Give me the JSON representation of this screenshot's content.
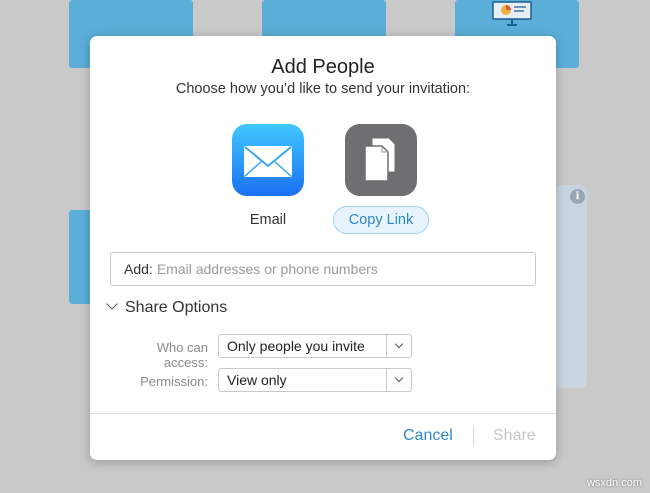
{
  "dialog": {
    "title": "Add People",
    "subtitle": "Choose how you’d like to send your invitation:",
    "options": [
      {
        "label": "Email",
        "icon": "mail-icon"
      },
      {
        "label": "Copy Link",
        "icon": "copy-documents-icon",
        "selected": true
      }
    ],
    "add_field": {
      "label": "Add:",
      "placeholder": "Email addresses or phone numbers"
    },
    "share_options": {
      "label": "Share Options",
      "who_can_access": {
        "label": "Who can access:",
        "value": "Only people you invite"
      },
      "permission": {
        "label": "Permission:",
        "value": "View only"
      }
    },
    "buttons": {
      "cancel": "Cancel",
      "share": "Share"
    }
  },
  "watermark": "wsxdn.com",
  "colors": {
    "accent": "#2f88c9",
    "tile": "#5aaed8",
    "backdrop": "#c9c9c9",
    "disabled": "#c6c6c6"
  }
}
